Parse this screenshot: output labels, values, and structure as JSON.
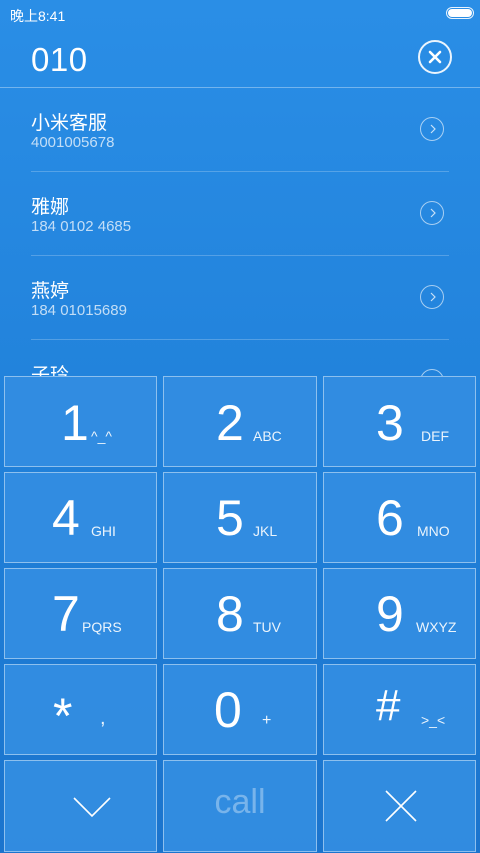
{
  "status_bar": {
    "time": "晚上8:41"
  },
  "search": {
    "number": "010"
  },
  "contacts": [
    {
      "name": "小米客服",
      "number": "4001005678"
    },
    {
      "name": "雅娜",
      "number": "184 0102 4685"
    },
    {
      "name": "燕婷",
      "number": "184 01015689"
    },
    {
      "name": "子玲",
      "number": ""
    }
  ],
  "keypad": {
    "keys": [
      {
        "digit": "1",
        "letters": "^_^"
      },
      {
        "digit": "2",
        "letters": "ABC"
      },
      {
        "digit": "3",
        "letters": "DEF"
      },
      {
        "digit": "4",
        "letters": "GHI"
      },
      {
        "digit": "5",
        "letters": "JKL"
      },
      {
        "digit": "6",
        "letters": "MNO"
      },
      {
        "digit": "7",
        "letters": "PQRS"
      },
      {
        "digit": "8",
        "letters": "TUV"
      },
      {
        "digit": "9",
        "letters": "WXYZ"
      },
      {
        "digit": "*",
        "letters": ","
      },
      {
        "digit": "0",
        "letters": "+"
      },
      {
        "digit": "#",
        "letters": ">_<"
      }
    ],
    "call_label": "call"
  },
  "colors": {
    "background": "#2182dc",
    "key": "#328ce1"
  }
}
